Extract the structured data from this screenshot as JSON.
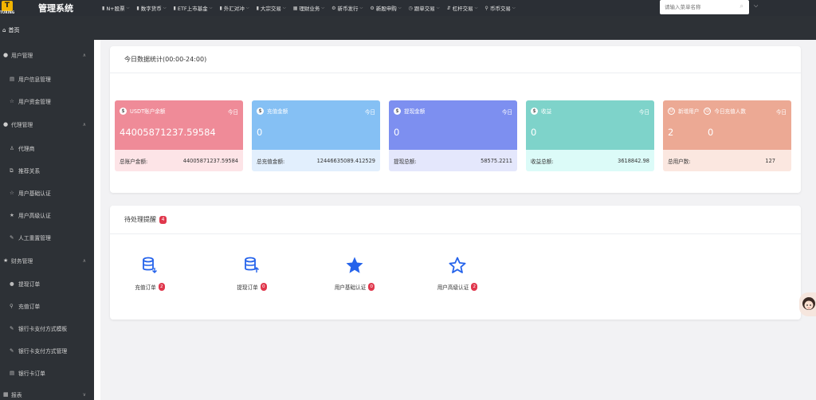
{
  "app": {
    "title": "管理系统",
    "logo_text": "TURING",
    "logo_letter": "T"
  },
  "topnav": [
    {
      "icon": "chart-icon",
      "glyph": "▮",
      "label": "N+股票"
    },
    {
      "icon": "chart-icon",
      "glyph": "▮",
      "label": "数字货币"
    },
    {
      "icon": "chart-icon",
      "glyph": "▮",
      "label": "ETF上市基金"
    },
    {
      "icon": "chart-icon",
      "glyph": "▮",
      "label": "外汇对冲"
    },
    {
      "icon": "chart-icon",
      "glyph": "▮",
      "label": "大宗交易"
    },
    {
      "icon": "grid-icon",
      "glyph": "▦",
      "label": "理财业务"
    },
    {
      "icon": "gear-icon",
      "glyph": "⚙",
      "label": "新币发行"
    },
    {
      "icon": "gear-icon",
      "glyph": "⚙",
      "label": "新股申购"
    },
    {
      "icon": "clock-icon",
      "glyph": "◷",
      "label": "跟单交易"
    },
    {
      "icon": "lever-icon",
      "glyph": "⇵",
      "label": "杠杆交易"
    },
    {
      "icon": "pin-icon",
      "glyph": "⚲",
      "label": "币币交易"
    }
  ],
  "search": {
    "placeholder": "请输入菜单名称"
  },
  "tabs": [
    {
      "label": "首页"
    }
  ],
  "sidebar": {
    "groups": [
      {
        "label": "用户管理",
        "items": [
          "用户信息管理",
          "用户资金管理"
        ]
      },
      {
        "label": "代理管理",
        "items": [
          "代理商",
          "推荐关系",
          "用户基础认证",
          "用户高级认证",
          "人工重置管理"
        ]
      },
      {
        "label": "财务管理",
        "items": [
          "提现订单",
          "充值订单",
          "银行卡支付方式模板",
          "银行卡支付方式管理",
          "银行卡订单"
        ]
      },
      {
        "label": "报表",
        "items": []
      }
    ]
  },
  "stats": {
    "title": "今日数据统计(00:00-24:00)",
    "today_label": "今日",
    "cards": [
      {
        "label": "USDT账户余额",
        "value": "44005871237.59584",
        "total_label": "总账户金额:",
        "total_value": "44005871237.59584",
        "color": "#ef8b98",
        "bottom_color": "#fde4e7"
      },
      {
        "label": "充值金额",
        "value": "0",
        "total_label": "总充值金额:",
        "total_value": "12446635089.412529",
        "color": "#85c0f4",
        "bottom_color": "#e2effd"
      },
      {
        "label": "提现金额",
        "value": "0",
        "total_label": "提现总额:",
        "total_value": "58575.2211",
        "color": "#7d8ff0",
        "bottom_color": "#e4e7fc"
      },
      {
        "label": "收益",
        "value": "0",
        "total_label": "收益总额:",
        "total_value": "3618842.98",
        "color": "#7ed3ca",
        "bottom_color": "#dcfbf8"
      },
      {
        "label": "新增用户",
        "label2": "今日充值人数",
        "value": "2",
        "value2": "0",
        "total_label": "总用户数:",
        "total_value": "127",
        "color": "#eca994",
        "bottom_color": "#fbe7e0"
      }
    ]
  },
  "pending": {
    "title": "待处理提醒",
    "count": "4",
    "items": [
      {
        "label": "充值订单",
        "count": "2",
        "icon": "database-down-icon"
      },
      {
        "label": "提现订单",
        "count": "0",
        "icon": "database-up-icon"
      },
      {
        "label": "用户基础认证",
        "count": "0",
        "icon": "star-filled-icon"
      },
      {
        "label": "用户高级认证",
        "count": "2",
        "icon": "star-outline-icon"
      }
    ]
  },
  "colors": {
    "accent": "#2563eb",
    "badge": "#e0374c",
    "sidebar": "#2d3136"
  }
}
